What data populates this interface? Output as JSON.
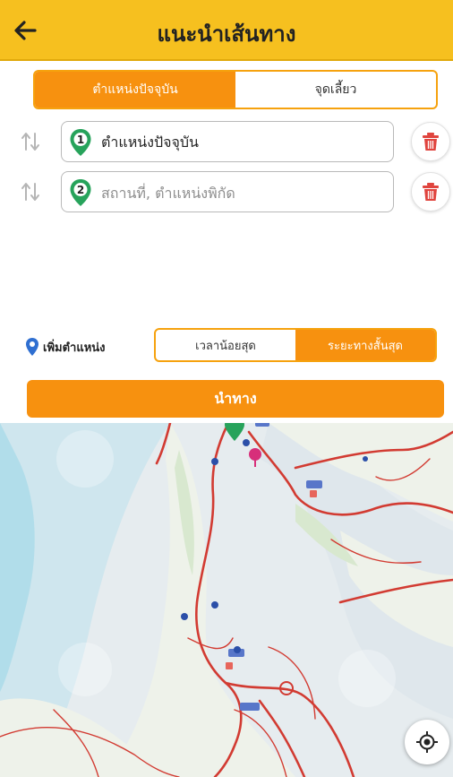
{
  "header": {
    "title": "แนะนำเส้นทาง",
    "back_icon": "arrow-left-icon"
  },
  "tabs": {
    "items": [
      {
        "label": "ตำแหน่งปัจจุบัน",
        "active": true
      },
      {
        "label": "จุดเลี้ยว",
        "active": false
      }
    ]
  },
  "route": {
    "stops": [
      {
        "number": "1",
        "value": "ตำแหน่งปัจจุบัน",
        "placeholder": ""
      },
      {
        "number": "2",
        "value": "",
        "placeholder": "สถานที่, ตำแหน่งพิกัด"
      }
    ]
  },
  "options": {
    "add_location_label": "เพิ่มตำแหน่ง",
    "modes": [
      {
        "label": "เวลาน้อยสุด",
        "active": false
      },
      {
        "label": "ระยะทางสั้นสุด",
        "active": true
      }
    ],
    "go_label": "นำทาง"
  },
  "colors": {
    "header": "#f6c01f",
    "accent": "#f7910f",
    "pin_green": "#27a35b",
    "trash_red": "#e0443e"
  }
}
